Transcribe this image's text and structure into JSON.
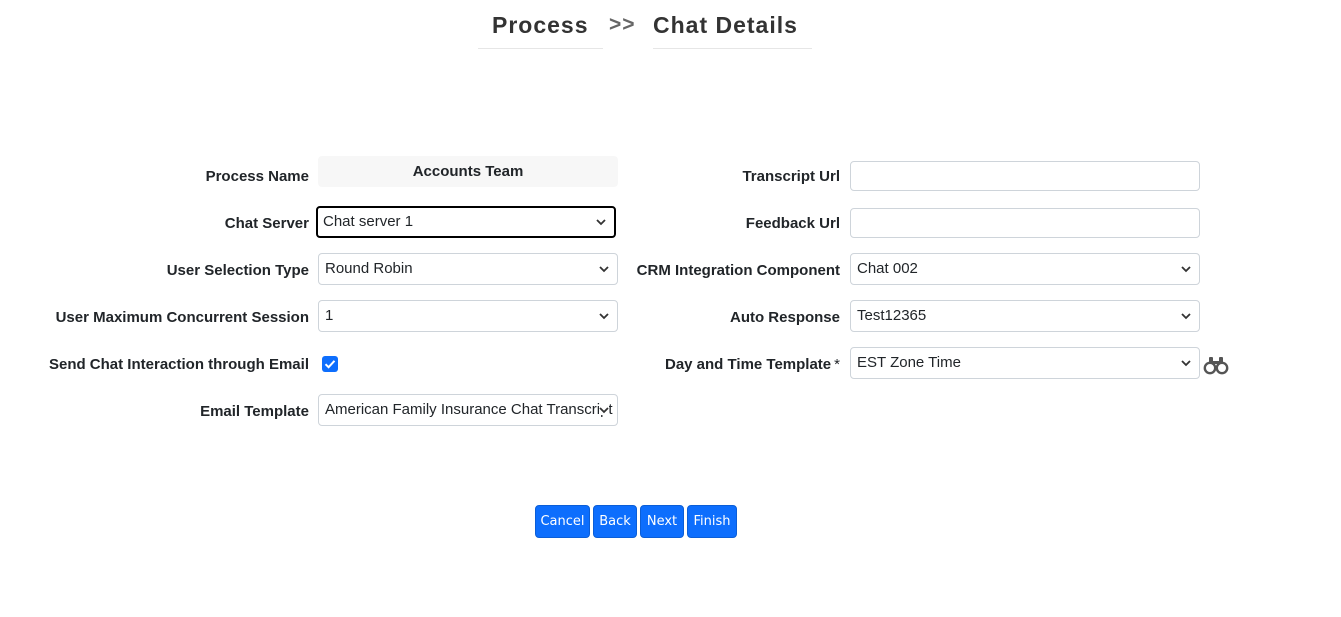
{
  "breadcrumb": {
    "step1": "Process",
    "separator": ">>",
    "step2": "Chat Details"
  },
  "left": {
    "process_name": {
      "label": "Process Name",
      "value": "Accounts Team"
    },
    "chat_server": {
      "label": "Chat Server",
      "value": "Chat server 1"
    },
    "user_selection_type": {
      "label": "User Selection Type",
      "value": "Round Robin"
    },
    "user_max_concurrent": {
      "label": "User Maximum Concurrent Session",
      "value": "1"
    },
    "send_chat_email": {
      "label": "Send Chat Interaction through Email",
      "checked": true
    },
    "email_template": {
      "label": "Email Template",
      "value": "American Family Insurance Chat Transcript"
    }
  },
  "right": {
    "transcript_url": {
      "label": "Transcript Url",
      "value": ""
    },
    "feedback_url": {
      "label": "Feedback Url",
      "value": ""
    },
    "crm_integration": {
      "label": "CRM Integration Component",
      "value": "Chat 002"
    },
    "auto_response": {
      "label": "Auto Response",
      "value": "Test12365"
    },
    "day_time_template": {
      "label": "Day and Time Template",
      "required_mark": "*",
      "value": "EST Zone Time",
      "lookup_icon": "binoculars-icon"
    }
  },
  "buttons": {
    "cancel": "Cancel",
    "back": "Back",
    "next": "Next",
    "finish": "Finish"
  },
  "colors": {
    "primary": "#0d6efd",
    "readonly_bg": "#f7f7f7",
    "border": "#ced4da"
  }
}
